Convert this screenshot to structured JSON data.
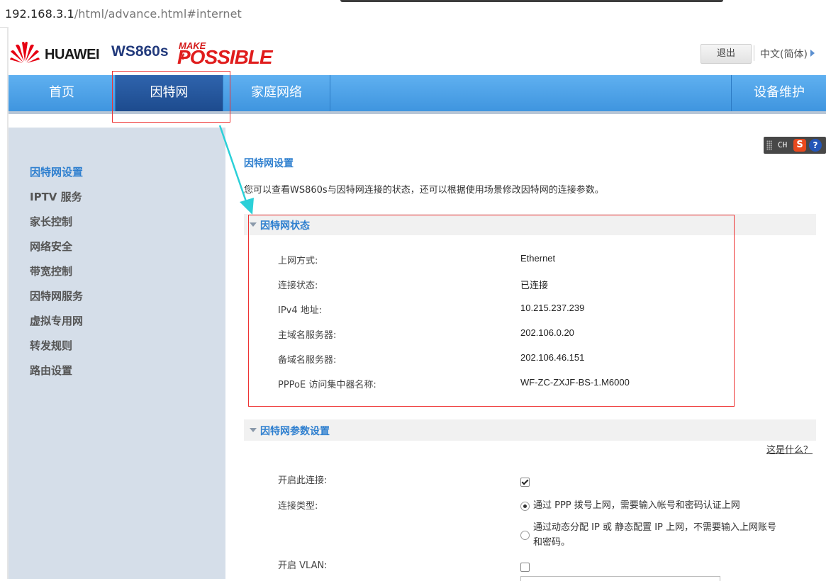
{
  "browser": {
    "url_host": "192.168.3.1",
    "url_path": "/html/advance.html#internet"
  },
  "header": {
    "brand": "HUAWEI",
    "model": "WS860s",
    "slogan_make": "MAKE it",
    "slogan_possible": "POSSIBLE",
    "logout_label": "退出",
    "language_label": "中文(简体)"
  },
  "nav": {
    "items": [
      "首页",
      "因特网",
      "家庭网络",
      "设备维护"
    ],
    "active": "因特网"
  },
  "sidebar": {
    "items": [
      "因特网设置",
      "IPTV 服务",
      "家长控制",
      "网络安全",
      "带宽控制",
      "因特网服务",
      "虚拟专用网",
      "转发规则",
      "路由设置"
    ],
    "active": "因特网设置"
  },
  "toolbar": {
    "ch_label": "CH",
    "s_label": "S",
    "help_label": "?"
  },
  "main": {
    "title": "因特网设置",
    "description": "您可以查看WS860s与因特网连接的状态，还可以根据使用场景修改因特网的连接参数。",
    "status_section": {
      "title": "因特网状态",
      "rows": [
        {
          "label": "上网方式:",
          "value": "Ethernet"
        },
        {
          "label": "连接状态:",
          "value": "已连接"
        },
        {
          "label": "IPv4 地址:",
          "value": "10.215.237.239"
        },
        {
          "label": "主域名服务器:",
          "value": "202.106.0.20"
        },
        {
          "label": "备域名服务器:",
          "value": "202.106.46.151"
        },
        {
          "label": "PPPoE 访问集中器名称:",
          "value": "WF-ZC-ZXJF-BS-1.M6000"
        }
      ]
    },
    "params_section": {
      "title": "因特网参数设置",
      "help_link": "这是什么？",
      "enable_label": "开启此连接:",
      "enable_checked": true,
      "conn_type_label": "连接类型:",
      "conn_options": [
        {
          "text_line1": "通过 PPP 拨号上网，需要输入帐号和密码认证上网",
          "text_line2": "",
          "selected": true
        },
        {
          "text_line1": "通过动态分配 IP 或 静态配置 IP 上网，不需要输入上网账号",
          "text_line2": "和密码。",
          "selected": false
        }
      ],
      "vlan_label": "开启 VLAN:",
      "vlan_checked": false
    }
  },
  "colors": {
    "accent": "#2e7fcf",
    "nav_blue": "#4a9fe6",
    "nav_active": "#24549a",
    "highlight_red": "#ee3333",
    "arrow_cyan": "#2bd0d8"
  }
}
